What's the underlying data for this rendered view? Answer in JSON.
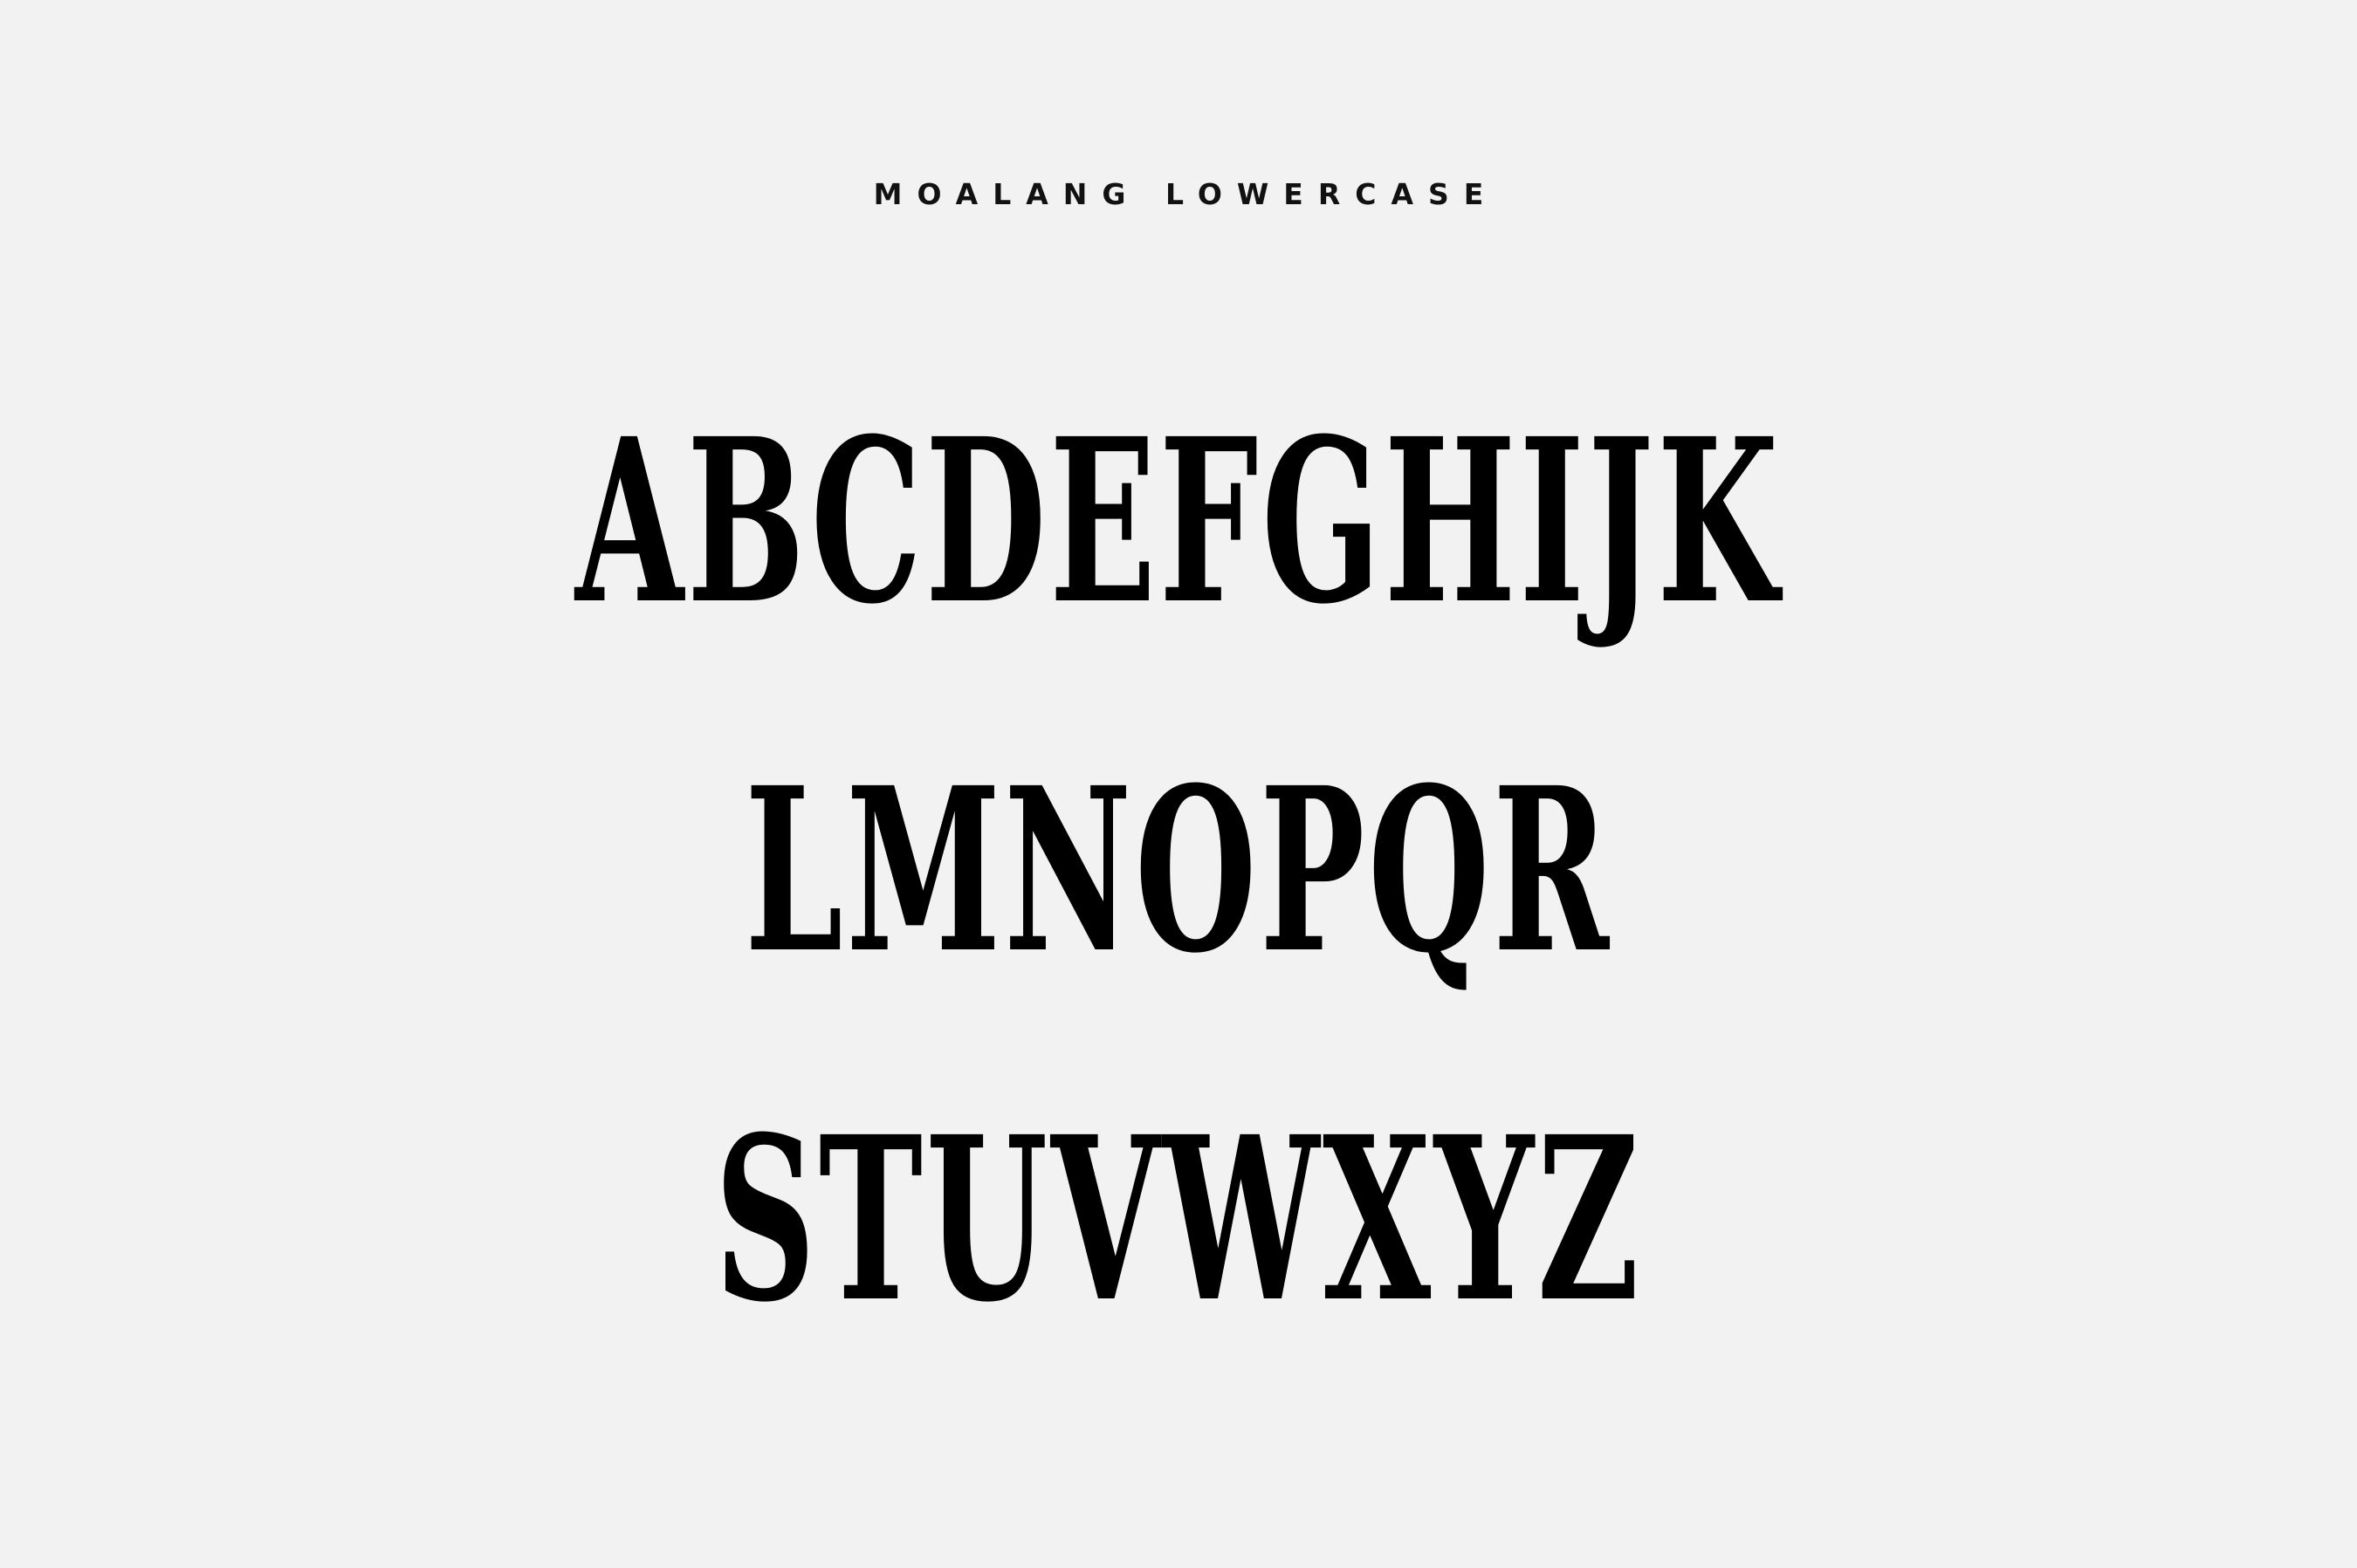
{
  "heading": "MOALANG LOWERCASE",
  "rows": [
    "ABCDEFGHIJK",
    "LMNOPQR",
    "STUVWXYZ"
  ]
}
